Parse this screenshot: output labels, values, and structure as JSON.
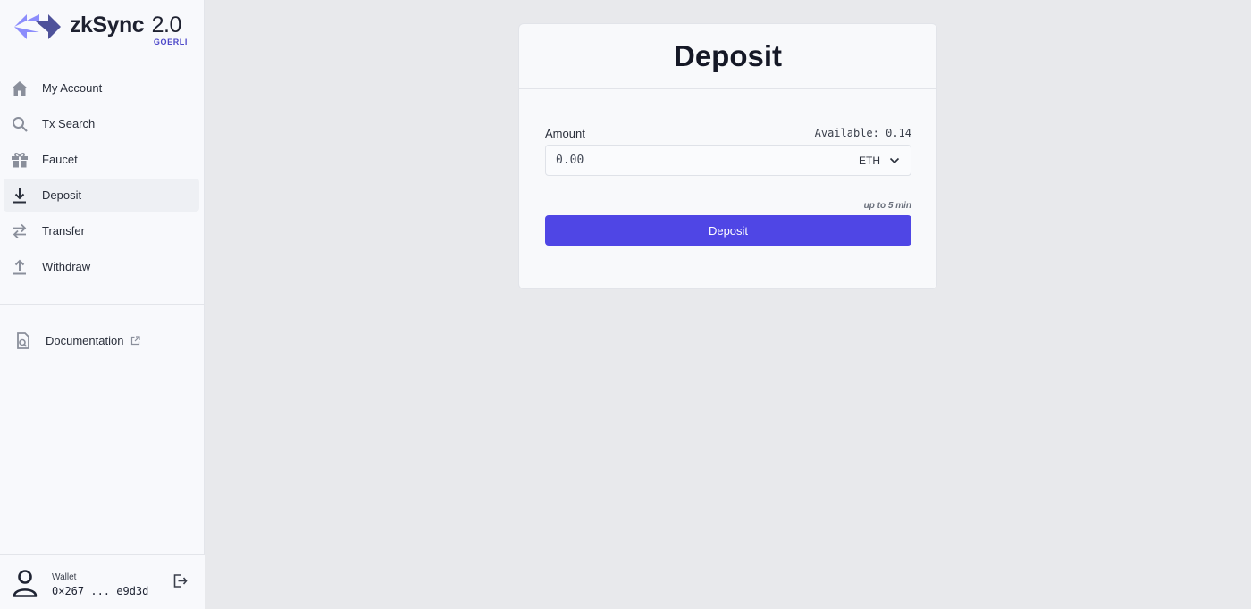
{
  "app": {
    "logo_name": "zkSync",
    "logo_version": "2.0",
    "network": "GOERLI",
    "accent": "#4f46e5",
    "logo_colors": [
      "#8c8dfc",
      "#4e529a"
    ]
  },
  "sidebar": {
    "items": [
      {
        "label": "My Account",
        "icon": "home-icon",
        "active": false
      },
      {
        "label": "Tx Search",
        "icon": "search-icon",
        "active": false
      },
      {
        "label": "Faucet",
        "icon": "gift-icon",
        "active": false
      },
      {
        "label": "Deposit",
        "icon": "download-icon",
        "active": true
      },
      {
        "label": "Transfer",
        "icon": "transfer-arrows-icon",
        "active": false
      },
      {
        "label": "Withdraw",
        "icon": "upload-icon",
        "active": false
      }
    ],
    "documentation": {
      "label": "Documentation",
      "icon": "document-search-icon",
      "external_icon": "external-link-icon"
    }
  },
  "wallet": {
    "label": "Wallet",
    "address": "0×267 ... e9d3d",
    "avatar_icon": "user-icon",
    "logout_icon": "logout-icon"
  },
  "deposit": {
    "title": "Deposit",
    "amount_label": "Amount",
    "available": "Available: 0.14",
    "amount_placeholder": "0.00",
    "token": "ETH",
    "eta": "up to 5 min",
    "button_label": "Deposit"
  }
}
